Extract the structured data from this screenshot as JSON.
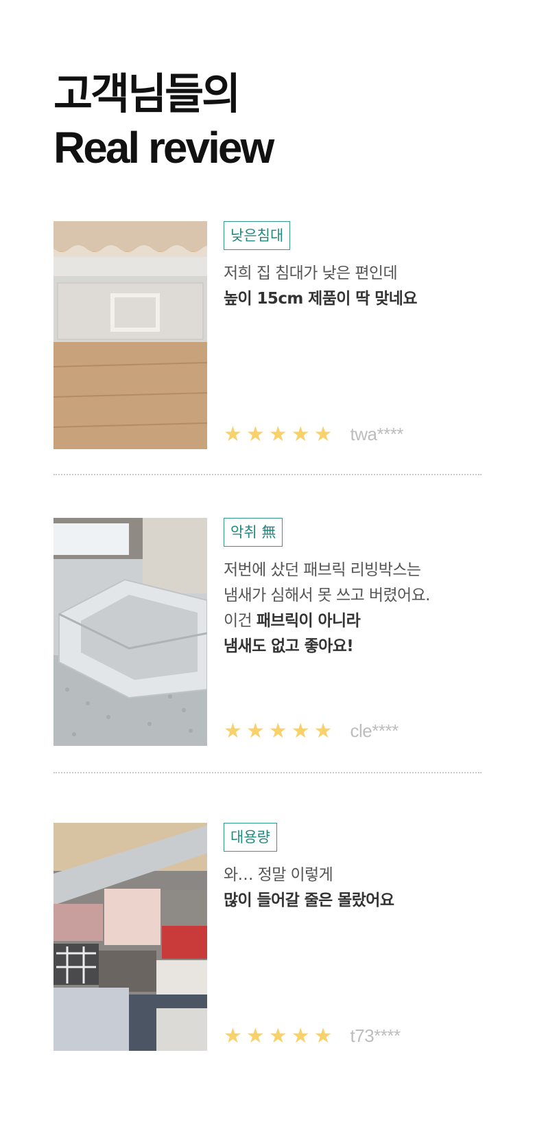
{
  "heading": {
    "line1": "고객님들의",
    "line2": "Real review"
  },
  "star_glyph": "★",
  "reviews": [
    {
      "photo": "underbed-storage-box-photo",
      "tag": "낮은침대",
      "text_line1": "저희 집 침대가 낮은 편인데",
      "text_line2_bold": "높이 15cm 제품이 딱 맞네요",
      "rating": 5,
      "user": "twa****"
    },
    {
      "photo": "fabric-storage-box-on-bed-photo",
      "tag": "악취 無",
      "text_line1": "저번에 샀던 패브릭 리빙박스는",
      "text_line2": "냄새가 심해서 못 쓰고 버렸어요.",
      "text_line3_prefix": "이건 ",
      "text_line3_bold": "패브릭이 아니라",
      "text_line4_bold": "냄새도 없고 좋아요!",
      "rating": 5,
      "user": "cle****"
    },
    {
      "photo": "clothes-in-storage-box-photo",
      "tag": "대용량",
      "text_line1": "와… 정말 이렇게",
      "text_line2_bold": "많이 들어갈 줄은 몰랐어요",
      "rating": 5,
      "user": "t73****"
    }
  ],
  "colors": {
    "tag": "#2f9a8d",
    "star": "#f8d16a",
    "user": "#bdbdbd",
    "divider": "#c9c9c9"
  }
}
